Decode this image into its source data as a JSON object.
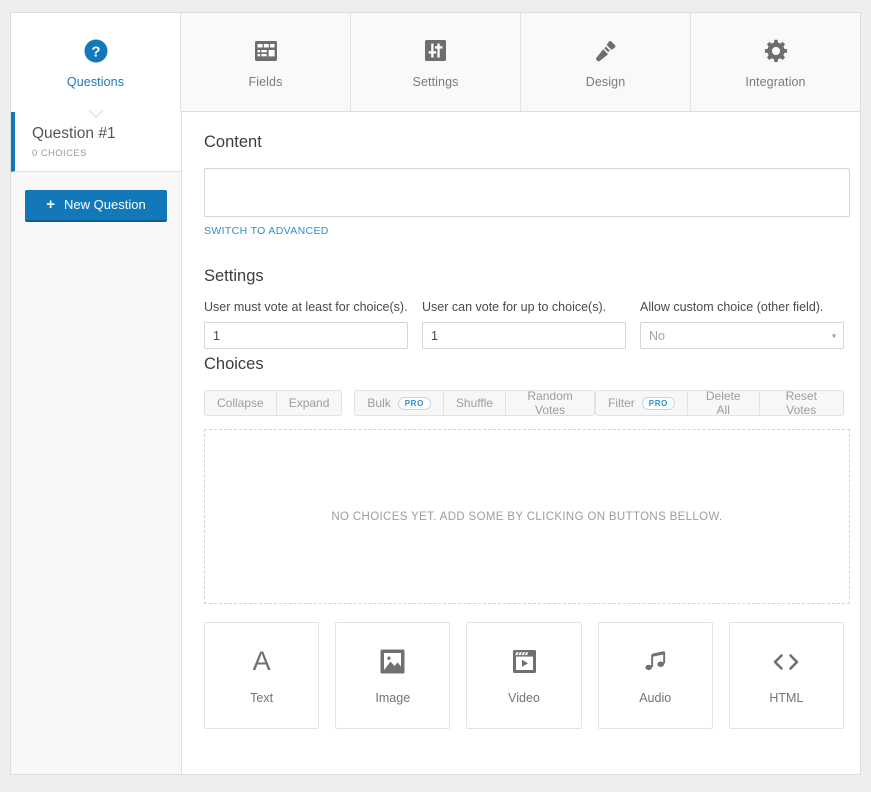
{
  "tabs": [
    {
      "label": "Questions",
      "icon": "question-circle-icon",
      "active": true
    },
    {
      "label": "Fields",
      "icon": "form-fields-icon",
      "active": false
    },
    {
      "label": "Settings",
      "icon": "sliders-icon",
      "active": false
    },
    {
      "label": "Design",
      "icon": "paintbrush-icon",
      "active": false
    },
    {
      "label": "Integration",
      "icon": "gear-icon",
      "active": false
    }
  ],
  "sidebar": {
    "question": {
      "title": "Question #1",
      "subtitle": "0 CHOICES"
    },
    "new_question_label": "New Question",
    "new_question_plus": "+"
  },
  "content": {
    "heading": "Content",
    "textarea_value": "",
    "textarea_placeholder": "",
    "switch_link": "SWITCH TO ADVANCED"
  },
  "settings": {
    "heading": "Settings",
    "fields": [
      {
        "label": "User must vote at least for choice(s).",
        "value": "1",
        "type": "text"
      },
      {
        "label": "User can vote for up to choice(s).",
        "value": "1",
        "type": "text"
      },
      {
        "label": "Allow custom choice (other field).",
        "value": "No",
        "type": "select"
      }
    ],
    "select_arrow": "▾"
  },
  "choices": {
    "heading": "Choices",
    "toolbar_left": [
      {
        "label": "Collapse",
        "pro": false
      },
      {
        "label": "Expand",
        "pro": false
      }
    ],
    "toolbar_middle": [
      {
        "label": "Bulk",
        "pro": true,
        "pro_label": "PRO"
      },
      {
        "label": "Shuffle",
        "pro": false
      },
      {
        "label": "Random Votes",
        "pro": false
      }
    ],
    "toolbar_right": [
      {
        "label": "Filter",
        "pro": true,
        "pro_label": "PRO"
      },
      {
        "label": "Delete All",
        "pro": false
      },
      {
        "label": "Reset Votes",
        "pro": false
      }
    ],
    "empty_text": "NO CHOICES YET. ADD SOME BY CLICKING ON BUTTONS BELLOW.",
    "types": [
      {
        "label": "Text",
        "icon": "letter-a-icon"
      },
      {
        "label": "Image",
        "icon": "image-icon"
      },
      {
        "label": "Video",
        "icon": "video-clapperboard-icon"
      },
      {
        "label": "Audio",
        "icon": "music-note-icon"
      },
      {
        "label": "HTML",
        "icon": "code-brackets-icon"
      }
    ]
  },
  "colors": {
    "accent": "#1278ba",
    "link": "#2d8fd0",
    "page_bg": "#efeeee",
    "sidebar_bg": "#f8f8f8",
    "muted_text": "#9d9d9d"
  }
}
